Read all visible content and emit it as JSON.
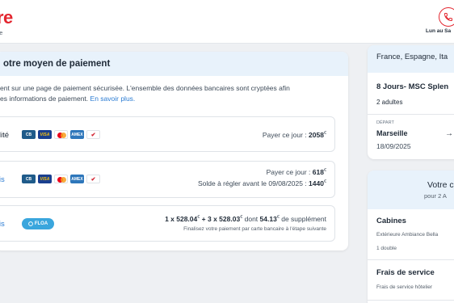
{
  "header": {
    "logo_text": "re",
    "logo_sub": "re",
    "hours": "Lun au Sa",
    "phone_icon": "phone-icon",
    "brand_color": "#e3262f"
  },
  "payment": {
    "title": "otre moyen de paiement",
    "secure_line1": "ent sur une page de paiement sécurisée. L'ensemble des données bancaires sont cryptées afin",
    "secure_line2": "es informations de paiement.",
    "learn_more": "En savoir plus.",
    "options": [
      {
        "label": "talité",
        "right_prefix": "Payer ce jour : ",
        "right_amount": "2058",
        "currency": "€"
      },
      {
        "label": "fois",
        "line1_prefix": "Payer ce jour : ",
        "line1_amount": "618",
        "line2_prefix": "Solde à régler avant le 09/08/2025 : ",
        "line2_amount": "1440",
        "currency": "€"
      },
      {
        "label": "fois",
        "badge": "FLOA",
        "l1_a": "1 x 528.04",
        "l1_b": " + 3 x 528.03",
        "l1_c": " dont ",
        "l1_d": "54.13",
        "l1_e": " de supplément",
        "currency": "€",
        "note": "Finalisez votre paiement par carte bancaire à l'étape suivante"
      }
    ],
    "card_brands": [
      "CB",
      "VISA",
      "mastercard",
      "AMEX",
      "oney"
    ]
  },
  "trip": {
    "destinations": "France, Espagne, Ita",
    "title": "8 Jours- MSC Splen",
    "adults": "2 adultes",
    "depart_label": "DÉPART",
    "city": "Marseille",
    "date": "18/09/2025"
  },
  "summary": {
    "title": "Votre c",
    "subtitle": "pour 2 A",
    "cabins_title": "Cabines",
    "cabins_desc": "Extérieure Ambiance Bella",
    "cabins_desc2": "1 double",
    "fees_title": "Frais de service",
    "fees_desc": "Frais de service hôtelier"
  },
  "colors": {
    "accent_blue": "#2b7cd3",
    "panel_blue": "#e8f2fb",
    "floa_blue": "#3aa6dd"
  }
}
